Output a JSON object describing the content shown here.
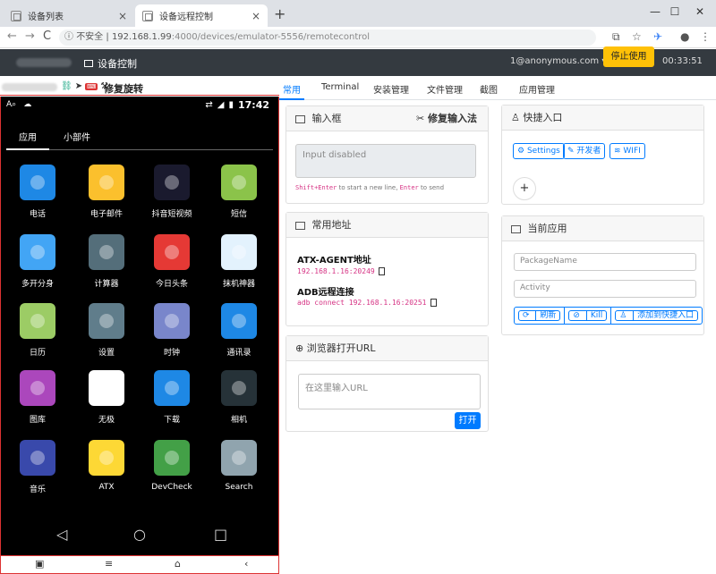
{
  "browser": {
    "tabs": [
      {
        "title": "设备列表",
        "close": "×"
      },
      {
        "title": "设备远程控制",
        "close": "×"
      }
    ],
    "new_tab": "+",
    "window_controls": {
      "minimize": "—",
      "maximize": "☐",
      "close": "✕"
    },
    "address": {
      "security": "不安全",
      "separator": "|",
      "host": "192.168.1.99",
      "path": ":4000/devices/emulator-5556/remotecontrol"
    }
  },
  "navbar": {
    "title": "设备控制",
    "user": "1@anonymous.com ▾",
    "stop_button": "停止使用",
    "timer": "00:33:51"
  },
  "device": {
    "header_label": "修复旋转",
    "status_time": "17:42",
    "status_left": "A⌕",
    "app_tabs": [
      "应用",
      "小部件"
    ],
    "apps": [
      {
        "label": "电话",
        "color": "#1e88e5",
        "icon": "phone-icon"
      },
      {
        "label": "电子邮件",
        "color": "#fbc02d",
        "icon": "email-icon"
      },
      {
        "label": "抖音短视频",
        "color": "#1a1a2e",
        "icon": "douyin-icon"
      },
      {
        "label": "短信",
        "color": "#8bc34a",
        "icon": "sms-icon"
      },
      {
        "label": "多开分身",
        "color": "#42a5f5",
        "icon": "multi-open-icon"
      },
      {
        "label": "计算器",
        "color": "#546e7a",
        "icon": "calculator-icon"
      },
      {
        "label": "今日头条",
        "color": "#e53935",
        "icon": "toutiao-icon"
      },
      {
        "label": "抹机神器",
        "color": "#e3f2fd",
        "icon": "wipe-icon"
      },
      {
        "label": "日历",
        "color": "#9ccc65",
        "icon": "calendar-icon"
      },
      {
        "label": "设置",
        "color": "#607d8b",
        "icon": "settings-icon"
      },
      {
        "label": "时钟",
        "color": "#7986cb",
        "icon": "clock-icon"
      },
      {
        "label": "通讯录",
        "color": "#1e88e5",
        "icon": "contacts-icon"
      },
      {
        "label": "图库",
        "color": "#ab47bc",
        "icon": "gallery-icon"
      },
      {
        "label": "无极",
        "color": "#ffffff",
        "icon": "wuji-icon"
      },
      {
        "label": "下载",
        "color": "#1e88e5",
        "icon": "download-icon"
      },
      {
        "label": "相机",
        "color": "#263238",
        "icon": "camera-icon"
      },
      {
        "label": "音乐",
        "color": "#3949ab",
        "icon": "music-icon"
      },
      {
        "label": "ATX",
        "color": "#fdd835",
        "icon": "atx-icon"
      },
      {
        "label": "DevCheck",
        "color": "#43a047",
        "icon": "devcheck-icon"
      },
      {
        "label": "Search",
        "color": "#90a4ae",
        "icon": "search-icon"
      }
    ],
    "nav": {
      "back": "◁",
      "home": "○",
      "recents": "□"
    },
    "bottom": {
      "a": "▣",
      "b": "≡",
      "c": "⌂",
      "d": "‹"
    }
  },
  "panel": {
    "tabs": [
      "常用",
      "Terminal",
      "安装管理",
      "文件管理",
      "截图",
      "应用管理"
    ],
    "input_card": {
      "title": "输入框",
      "fix_label": "修复输入法",
      "placeholder": "Input disabled",
      "hint_key1": "Shift+Enter",
      "hint_mid": " to start a new line, ",
      "hint_key2": "Enter",
      "hint_end": " to send"
    },
    "address_card": {
      "title": "常用地址",
      "atx_title": "ATX-AGENT地址",
      "atx_value": "192.168.1.16:20249",
      "adb_title": "ADB远程连接",
      "adb_value": "adb connect 192.168.1.16:20251"
    },
    "url_card": {
      "title": "浏览器打开URL",
      "placeholder": "在这里输入URL",
      "open_button": "打开"
    },
    "shortcut_card": {
      "title": "快捷入口",
      "buttons": [
        "Settings",
        "开发者",
        "WIFI"
      ],
      "add": "+"
    },
    "current_app_card": {
      "title": "当前应用",
      "package_placeholder": "PackageName",
      "activity_placeholder": "Activity",
      "refresh": "刷新",
      "kill": "Kill",
      "add_shortcut": "添加到快捷入口"
    }
  }
}
